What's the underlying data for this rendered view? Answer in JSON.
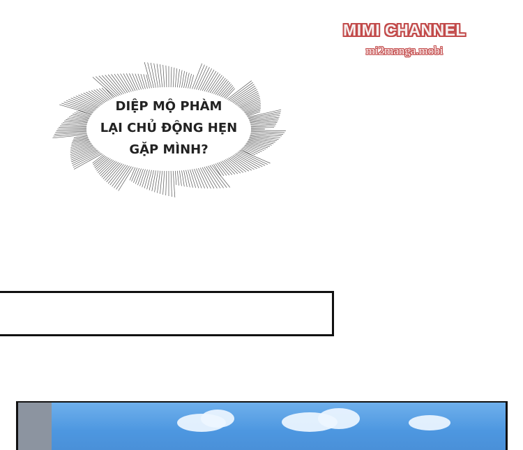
{
  "watermark": {
    "title": "MIMI CHANNEL",
    "url": "mi2manga.mobi"
  },
  "speech_bubble": {
    "lines": [
      "DIỆP MỘ PHÀM",
      "LẠI CHỦ ĐỘNG HẸN",
      "GẶP MÌNH?"
    ]
  },
  "colors": {
    "watermark_outline": "#c24a4a",
    "sky": "#4d97e0",
    "cloud": "#eef6ff"
  }
}
